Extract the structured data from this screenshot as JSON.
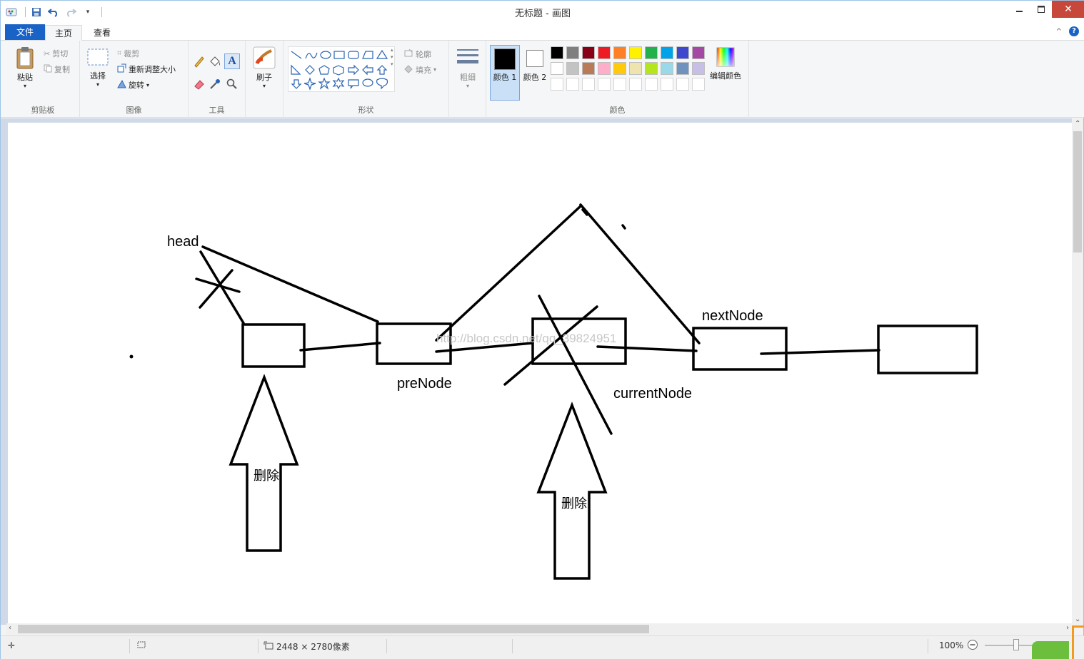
{
  "window": {
    "title": "无标题 - 画图",
    "minimize_icon": "minimize-icon",
    "maximize_icon": "maximize-icon",
    "close_icon": "close-icon"
  },
  "quick_access": [
    "save-icon",
    "undo-icon",
    "redo-icon",
    "customize-icon"
  ],
  "tabs": [
    {
      "label": "文件"
    },
    {
      "label": "主页"
    },
    {
      "label": "查看"
    }
  ],
  "ribbon": {
    "clipboard": {
      "paste": "粘贴",
      "cut": "剪切",
      "copy": "复制",
      "group_label": "剪贴板"
    },
    "image": {
      "select": "选择",
      "crop": "裁剪",
      "resize": "重新调整大小",
      "rotate": "旋转",
      "group_label": "图像"
    },
    "tools": {
      "group_label": "工具",
      "text_tool": "A"
    },
    "brushes": {
      "label": "刷子"
    },
    "shapes": {
      "outline": "轮廓",
      "fill": "填充",
      "group_label": "形状"
    },
    "size": {
      "label": "粗细"
    },
    "colors": {
      "color1": "颜色 1",
      "color2": "颜色 2",
      "edit_colors": "编辑颜色",
      "group_label": "颜色",
      "color1_value": "#000000",
      "color2_value": "#ffffff",
      "palette_row1": [
        "#000000",
        "#7f7f7f",
        "#880015",
        "#ed1c24",
        "#ff7f27",
        "#fff200",
        "#22b14c",
        "#00a2e8",
        "#3f48cc",
        "#a349a4"
      ],
      "palette_row2": [
        "#ffffff",
        "#c3c3c3",
        "#b97a57",
        "#ffaec9",
        "#ffc90e",
        "#efe4b0",
        "#b5e61d",
        "#99d9ea",
        "#7092be",
        "#c8bfe7"
      ]
    }
  },
  "canvas": {
    "labels": {
      "head": "head",
      "preNode": "preNode",
      "nextNode": "nextNode",
      "currentNode": "currentNode",
      "delete1": "删除",
      "delete2": "删除",
      "watermark": "http://blog.csdn.net/qq_39824951"
    }
  },
  "statusbar": {
    "dimensions": "2448 × 2780像素",
    "zoom": "100%"
  }
}
